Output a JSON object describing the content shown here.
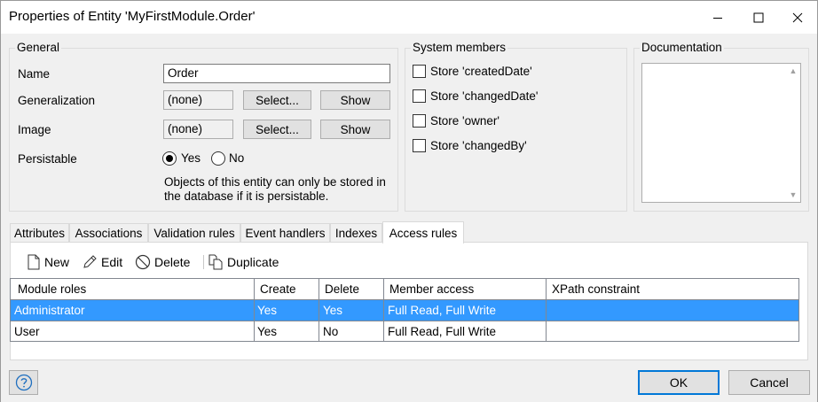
{
  "window": {
    "title": "Properties of Entity 'MyFirstModule.Order'"
  },
  "general": {
    "legend": "General",
    "name_label": "Name",
    "name_value": "Order",
    "generalization_label": "Generalization",
    "generalization_value": "(none)",
    "image_label": "Image",
    "image_value": "(none)",
    "select_label": "Select...",
    "show_label": "Show",
    "persistable_label": "Persistable",
    "yes_label": "Yes",
    "no_label": "No",
    "persistable_selected": "Yes",
    "note_line1": "Objects of this entity can only be stored in",
    "note_line2": "the database if it is persistable."
  },
  "system_members": {
    "legend": "System members",
    "items": [
      {
        "label": "Store 'createdDate'",
        "checked": false
      },
      {
        "label": "Store 'changedDate'",
        "checked": false
      },
      {
        "label": "Store 'owner'",
        "checked": false
      },
      {
        "label": "Store 'changedBy'",
        "checked": false
      }
    ]
  },
  "documentation": {
    "legend": "Documentation",
    "text": ""
  },
  "tabs": [
    {
      "label": "Attributes",
      "active": false
    },
    {
      "label": "Associations",
      "active": false
    },
    {
      "label": "Validation rules",
      "active": false
    },
    {
      "label": "Event handlers",
      "active": false
    },
    {
      "label": "Indexes",
      "active": false
    },
    {
      "label": "Access rules",
      "active": true
    }
  ],
  "toolbar": {
    "new_label": "New",
    "edit_label": "Edit",
    "delete_label": "Delete",
    "duplicate_label": "Duplicate"
  },
  "access_rules": {
    "columns": [
      "Module roles",
      "Create",
      "Delete",
      "Member access",
      "XPath constraint"
    ],
    "rows": [
      {
        "module_role": "Administrator",
        "create": "Yes",
        "delete": "Yes",
        "member_access": "Full Read, Full Write",
        "xpath": "",
        "selected": true
      },
      {
        "module_role": "User",
        "create": "Yes",
        "delete": "No",
        "member_access": "Full Read, Full Write",
        "xpath": "",
        "selected": false
      }
    ]
  },
  "footer": {
    "ok_label": "OK",
    "cancel_label": "Cancel"
  },
  "colors": {
    "selection": "#3399ff",
    "default_button_border": "#0078d7"
  }
}
